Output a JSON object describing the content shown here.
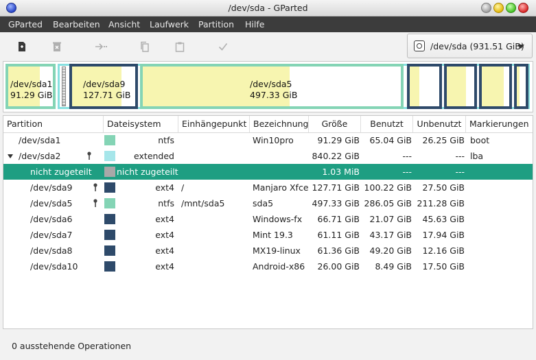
{
  "window": {
    "title": "/dev/sda - GParted"
  },
  "menu": {
    "items": [
      "GParted",
      "Bearbeiten",
      "Ansicht",
      "Laufwerk",
      "Partition",
      "Hilfe"
    ]
  },
  "toolbar": {
    "buttons": [
      {
        "icon": "new-partition-icon",
        "enabled": true
      },
      {
        "icon": "delete-partition-icon",
        "enabled": false
      },
      {
        "icon": "resize-move-icon",
        "enabled": false
      },
      {
        "icon": "copy-icon",
        "enabled": false
      },
      {
        "icon": "paste-icon",
        "enabled": false
      },
      {
        "icon": "apply-icon",
        "enabled": false
      }
    ],
    "device_selector": "/dev/sda (931.51 GiB)"
  },
  "diskmap": {
    "labels": [
      {
        "name": "/dev/sda1",
        "size": "91.29 GiB"
      },
      {
        "name": "/dev/sda9",
        "size": "127.71 GiB"
      },
      {
        "name": "/dev/sda5",
        "size": "497.33 GiB"
      }
    ]
  },
  "table": {
    "columns": [
      "Partition",
      "Dateisystem",
      "Einhängepunkt",
      "Bezeichnung",
      "Größe",
      "Benutzt",
      "Unbenutzt",
      "Markierungen"
    ],
    "rows": [
      {
        "partition": "/dev/sda1",
        "fs": "ntfs",
        "mount": "",
        "label": "Win10pro",
        "size": "91.29 GiB",
        "used": "65.04 GiB",
        "unused": "26.25 GiB",
        "flags": "boot",
        "color": "#84d4b5",
        "locked": false
      },
      {
        "partition": "/dev/sda2",
        "fs": "extended",
        "mount": "",
        "label": "",
        "size": "840.22 GiB",
        "used": "---",
        "unused": "---",
        "flags": "lba",
        "color": "#a6e6ea",
        "locked": true
      },
      {
        "partition": "nicht zugeteilt",
        "fs": "nicht zugeteilt",
        "mount": "",
        "label": "",
        "size": "1.03 MiB",
        "used": "---",
        "unused": "---",
        "flags": "",
        "color": "#a8a8a8",
        "locked": false
      },
      {
        "partition": "/dev/sda9",
        "fs": "ext4",
        "mount": "/",
        "label": "Manjaro Xfce",
        "size": "127.71 GiB",
        "used": "100.22 GiB",
        "unused": "27.50 GiB",
        "flags": "",
        "color": "#2e4a6a",
        "locked": true
      },
      {
        "partition": "/dev/sda5",
        "fs": "ntfs",
        "mount": "/mnt/sda5",
        "label": "sda5",
        "size": "497.33 GiB",
        "used": "286.05 GiB",
        "unused": "211.28 GiB",
        "flags": "",
        "color": "#84d4b5",
        "locked": true
      },
      {
        "partition": "/dev/sda6",
        "fs": "ext4",
        "mount": "",
        "label": "Windows-fx",
        "size": "66.71 GiB",
        "used": "21.07 GiB",
        "unused": "45.63 GiB",
        "flags": "",
        "color": "#2e4a6a",
        "locked": false
      },
      {
        "partition": "/dev/sda7",
        "fs": "ext4",
        "mount": "",
        "label": "Mint 19.3",
        "size": "61.11 GiB",
        "used": "43.17 GiB",
        "unused": "17.94 GiB",
        "flags": "",
        "color": "#2e4a6a",
        "locked": false
      },
      {
        "partition": "/dev/sda8",
        "fs": "ext4",
        "mount": "",
        "label": "MX19-linux",
        "size": "61.36 GiB",
        "used": "49.20 GiB",
        "unused": "12.16 GiB",
        "flags": "",
        "color": "#2e4a6a",
        "locked": false
      },
      {
        "partition": "/dev/sda10",
        "fs": "ext4",
        "mount": "",
        "label": "Android-x86",
        "size": "26.00 GiB",
        "used": "8.49 GiB",
        "unused": "17.50 GiB",
        "flags": "",
        "color": "#2e4a6a",
        "locked": false
      }
    ]
  },
  "status": {
    "text": "0 ausstehende Operationen"
  },
  "colors": {
    "ntfs": "#84d4b5",
    "ext4": "#2e4a6a",
    "extended": "#87e0e0",
    "used": "#f7f5b0",
    "selection": "#1e9e82",
    "menubar": "#3c3c3c"
  }
}
